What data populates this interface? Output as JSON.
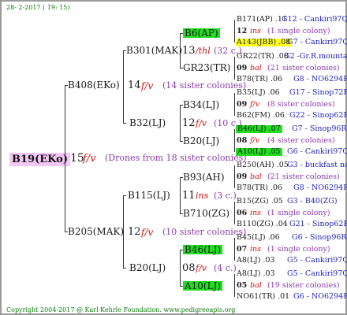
{
  "header": {
    "date": "28- 2-2017 ( 19: 15)"
  },
  "footer": {
    "copyright": "Copyright 2004-2017 @ Karl Kehrle Foundation.   www.pedigreeapis.org"
  },
  "colors": {
    "highlight_green": "#22dd22",
    "highlight_yellow": "#ffff22",
    "root_bg": "#f6c6f6",
    "red": "#d01010",
    "blue": "#1f1fb0",
    "green": "#0a7a0a"
  },
  "root": {
    "label": "B19(EKo)",
    "num": "15",
    "code": "f/v",
    "sisters": "(Drones from 18 sister colonies)"
  },
  "gen1": [
    {
      "label": "B408(EKo)",
      "num": "14",
      "code": "f/v",
      "sisters": "(14 sister colonies)"
    },
    {
      "label": "B205(MAK)",
      "num": "12",
      "code": "f/v",
      "sisters": "(10 sister colonies)"
    }
  ],
  "gen2": [
    {
      "label": "B301(MAK)",
      "num": "13",
      "code": "/thl",
      "sisters": "(32 c.)"
    },
    {
      "label": "B32(LJ)",
      "num": "12",
      "code": "f/v",
      "sisters": "(10 c.)"
    },
    {
      "label": "B115(LJ)",
      "num": "11",
      "code": "ins",
      "sisters": "(3 c.)"
    },
    {
      "label": "B20(LJ)",
      "num": "08",
      "code": "f/v",
      "sisters": "(4 c.)"
    }
  ],
  "gen3": [
    {
      "label": "B6(AP)"
    },
    {
      "label": "GR23(TR)"
    },
    {
      "label": "B34(LJ)"
    },
    {
      "label": "B20(LJ)"
    },
    {
      "label": "B93(AH)"
    },
    {
      "label": "B710(ZG)"
    },
    {
      "label": "B46(LJ)"
    },
    {
      "label": "A10(LJ)"
    }
  ],
  "gen4": [
    {
      "top": "B171(AP) .11",
      "top_ref": "G12 - Cankiri97Q",
      "num": "12",
      "code": "ins",
      "sis": "(1 single colony)",
      "bot": "A143(JBB) .08",
      "bot_ref": "G7 - Cankiri97Q"
    },
    {
      "top": "GR22(TR) .08",
      "top_ref": "G2 -Gr.R.mounta",
      "num": "09",
      "code": "bal",
      "sis": "(21 sister colonies)",
      "bot": "B78(TR) .06",
      "bot_ref": "G8 - NO6294R"
    },
    {
      "top": "B35(LJ) .06",
      "top_ref": "G17 - Sinop72R",
      "num": "09",
      "code": "f/v",
      "sis": "(8 sister colonies)",
      "bot": "B62(FM) .06",
      "bot_ref": "G22 - Sinop62R"
    },
    {
      "top": "B46(LJ) .07",
      "top_ref": "G7 - Sinop96R",
      "num": "08",
      "code": "f/v",
      "sis": "(4 sister colonies)",
      "bot": "A10(LJ) .05",
      "bot_ref": "G6 - Cankiri97Q"
    },
    {
      "top": "B250(AH) .05",
      "top_ref": "G3 - buckfast no",
      "num": "09",
      "code": "bal",
      "sis": "(21 sister colonies)",
      "bot": "B78(TR) .06",
      "bot_ref": "G8 - NO6294R"
    },
    {
      "top": "B15(ZG) .05",
      "top_ref": "G3 - B40(ZG)",
      "num": "06",
      "code": "ins",
      "sis": "(1 single colony)",
      "bot": "B110(ZG) .04",
      "bot_ref": "G21 - Sinop62R"
    },
    {
      "top": "B45(LJ) .06",
      "top_ref": "G6 - Sinop96R",
      "num": "07",
      "code": "ins",
      "sis": "(1 single colony)",
      "bot": "A8(LJ) .03",
      "bot_ref": "G5 - Cankiri97Q"
    },
    {
      "top": "A8(LJ) .03",
      "top_ref": "G5 - Cankiri97Q",
      "num": "05",
      "code": "bal",
      "sis": "(19 sister colonies)",
      "bot": "NO61(TR) .01",
      "bot_ref": "G6 - NO6294R"
    }
  ]
}
